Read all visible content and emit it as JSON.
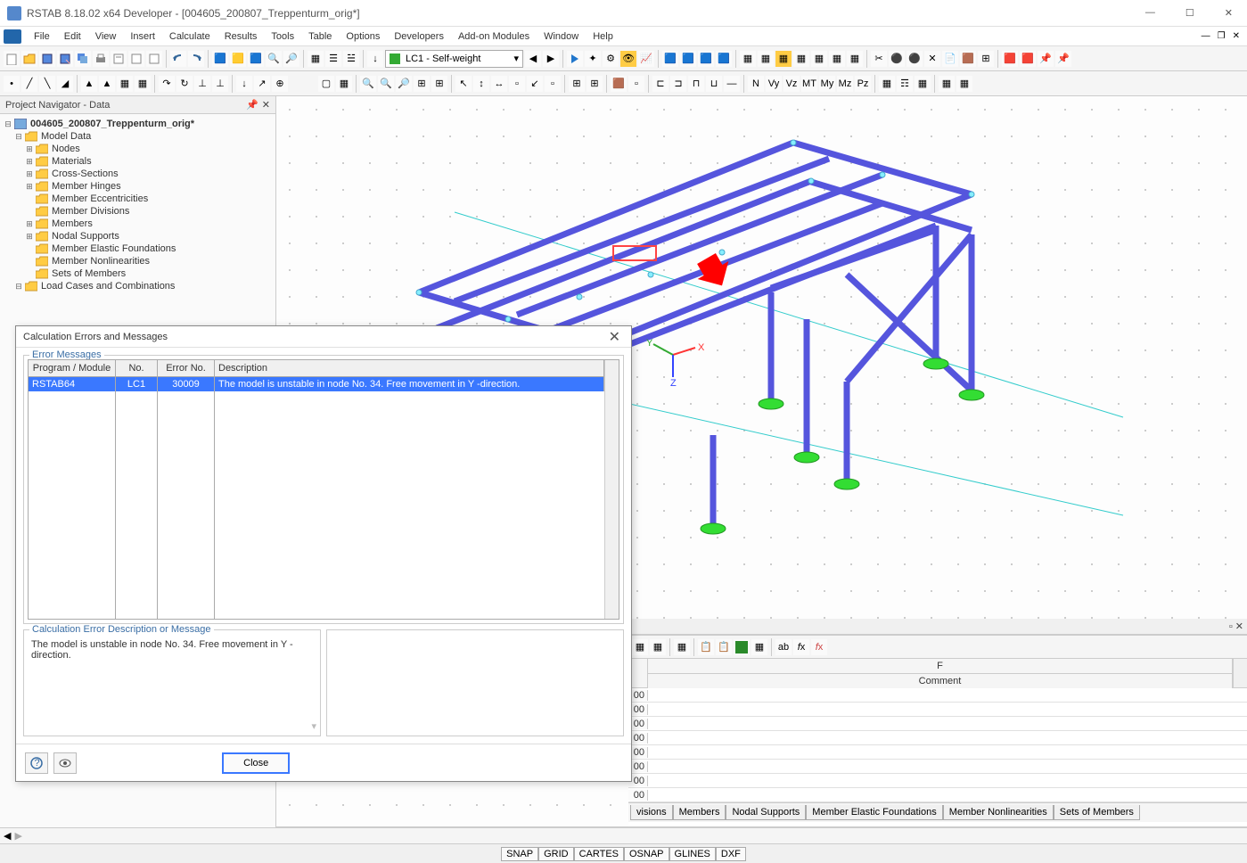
{
  "window": {
    "title": "RSTAB 8.18.02 x64 Developer - [004605_200807_Treppenturm_orig*]"
  },
  "menu": [
    "File",
    "Edit",
    "View",
    "Insert",
    "Calculate",
    "Results",
    "Tools",
    "Table",
    "Options",
    "Developers",
    "Add-on Modules",
    "Window",
    "Help"
  ],
  "lc_combo": "LC1 - Self-weight",
  "navigator": {
    "title": "Project Navigator - Data",
    "root": "004605_200807_Treppenturm_orig*",
    "model_data": "Model Data",
    "nodes": [
      "Nodes",
      "Materials",
      "Cross-Sections",
      "Member Hinges",
      "Member Eccentricities",
      "Member Divisions",
      "Members",
      "Nodal Supports",
      "Member Elastic Foundations",
      "Member Nonlinearities",
      "Sets of Members"
    ],
    "lcc": "Load Cases and Combinations"
  },
  "dialog": {
    "title": "Calculation Errors and Messages",
    "section1": "Error Messages",
    "cols": [
      "Program / Module",
      "No.",
      "Error No.",
      "Description"
    ],
    "row": {
      "prog": "RSTAB64",
      "no": "LC1",
      "errno": "30009",
      "desc": "The model is unstable in node No. 34. Free movement in Y -direction."
    },
    "section2": "Calculation Error Description or Message",
    "desc_long": "The model is unstable in node No. 34. Free movement in Y -direction.",
    "close": "Close"
  },
  "bottom_panel": {
    "col_f": "F",
    "col_comment": "Comment",
    "suffix_vals": [
      "00",
      "00",
      "00",
      "00",
      "00",
      "00",
      "00",
      "00"
    ],
    "tabs": [
      "visions",
      "Members",
      "Nodal Supports",
      "Member Elastic Foundations",
      "Member Nonlinearities",
      "Sets of Members"
    ]
  },
  "status": [
    "SNAP",
    "GRID",
    "CARTES",
    "OSNAP",
    "GLINES",
    "DXF"
  ]
}
